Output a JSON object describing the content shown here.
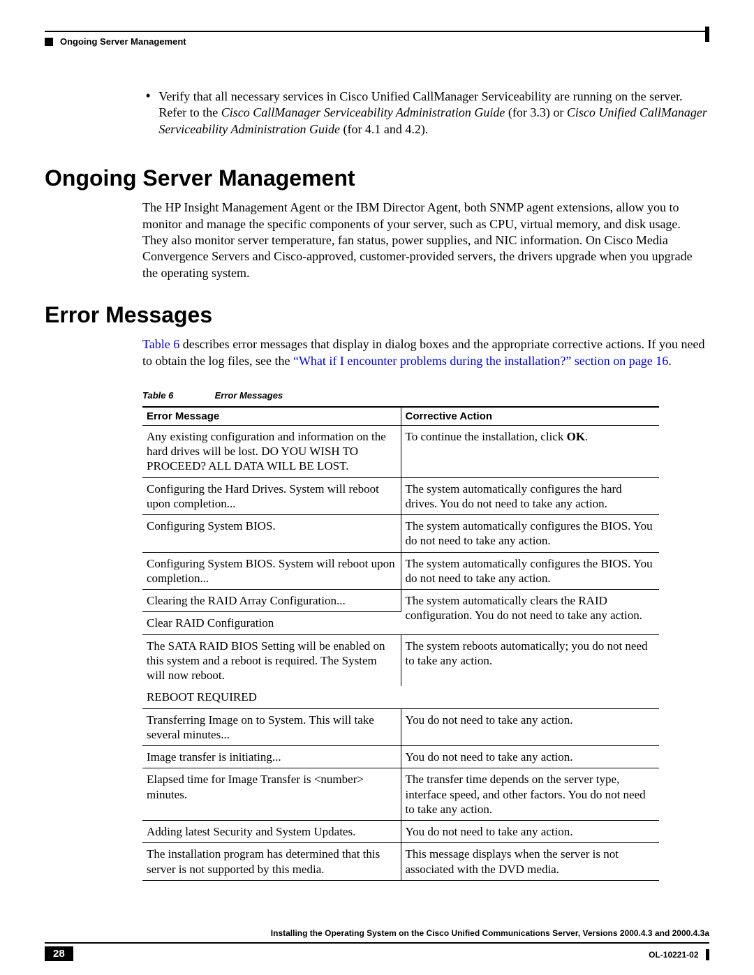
{
  "header": {
    "section_marker": "Ongoing Server Management"
  },
  "bullet": {
    "text_a": "Verify that all necessary services in Cisco Unified CallManager Serviceability are running on the server. Refer to the ",
    "italic_a": "Cisco CallManager Serviceability Administration Guide",
    "text_b": " (for 3.3) or ",
    "italic_b": "Cisco Unified CallManager Serviceability Administration Guide",
    "text_c": " (for 4.1 and 4.2)."
  },
  "section1": {
    "title": "Ongoing Server Management",
    "para": "The HP Insight Management Agent or the IBM Director Agent, both SNMP agent extensions, allow you to monitor and manage the specific components of your server, such as CPU, virtual memory, and disk usage. They also monitor server temperature, fan status, power supplies, and NIC information. On Cisco Media Convergence Servers and Cisco-approved, customer-provided servers, the drivers upgrade when you upgrade the operating system."
  },
  "section2": {
    "title": "Error Messages",
    "para_a": "Table 6",
    "para_b": " describes error messages that display in dialog boxes and the appropriate corrective actions. If you need to obtain the log files, see the ",
    "para_link": "“What if I encounter problems during the installation?” section on page 16",
    "para_c": "."
  },
  "table": {
    "caption_label": "Table 6",
    "caption_title": "Error Messages",
    "headers": {
      "col1": "Error Message",
      "col2": "Corrective Action"
    },
    "rows": [
      {
        "msg": "Any existing configuration and information on the hard drives will be lost. DO YOU WISH TO PROCEED? ALL DATA WILL BE LOST.",
        "action_a": "To continue the installation, click ",
        "action_bold": "OK",
        "action_b": "."
      },
      {
        "msg": "Configuring the Hard Drives. System will reboot upon completion...",
        "action": "The system automatically configures the hard drives. You do not need to take any action."
      },
      {
        "msg": "Configuring System BIOS.",
        "action": "The system automatically configures the BIOS. You do not need to take any action."
      },
      {
        "msg": "Configuring System BIOS. System will reboot upon completion...",
        "action": "The system automatically configures the BIOS. You do not need to take any action."
      },
      {
        "msg": "Clearing the RAID Array Configuration...",
        "action": "The system automatically clears the RAID configuration. You do not need to take any action."
      },
      {
        "msg": "Clear RAID Configuration",
        "action": ""
      },
      {
        "msg": "The SATA RAID BIOS Setting will be enabled on this system and a reboot is required. The System will now reboot.",
        "action": "The system reboots automatically; you do not need to take any action."
      },
      {
        "msg": "REBOOT REQUIRED",
        "action": ""
      },
      {
        "msg": "Transferring Image on to System. This will take several minutes...",
        "action": "You do not need to take any action."
      },
      {
        "msg": "Image transfer is initiating...",
        "action": "You do not need to take any action."
      },
      {
        "msg": "Elapsed time for Image Transfer is <number> minutes.",
        "action": "The transfer time depends on the server type, interface speed, and other factors. You do not need to take any action."
      },
      {
        "msg": "Adding latest Security and System Updates.",
        "action": "You do not need to take any action."
      },
      {
        "msg": "The installation program has determined that this server is not supported by this media.",
        "action": "This message displays when the server is not associated with the DVD media."
      }
    ]
  },
  "footer": {
    "doc_title": "Installing the Operating System on the Cisco Unified Communications Server, Versions 2000.4.3 and 2000.4.3a",
    "page_number": "28",
    "doc_id": "OL-10221-02"
  }
}
